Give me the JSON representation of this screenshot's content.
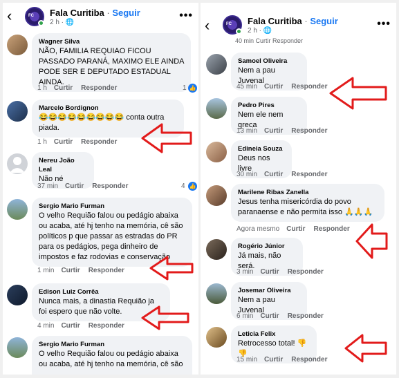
{
  "page": {
    "name": "Fala Curitiba",
    "separator": "·",
    "follow_label": "Seguir",
    "meta": "2 h · ",
    "globe_icon": "globe-icon",
    "more_label": "•••",
    "back_label": "‹",
    "logo_text": "Fala Curitiba"
  },
  "actions": {
    "like": "Curtir",
    "reply": "Responder"
  },
  "left_comments": [
    {
      "author": "Wagner Silva",
      "text": "NÃO, FAMILIA REQUIAO FICOU PASSADO PARANÁ, MAXIMO ELE AINDA PODE SER E DEPUTADO ESTADUAL AINDA.",
      "time": "1 h",
      "likes": "1"
    },
    {
      "author": "Marcelo Bordignon",
      "text": "😂😂😂😂😂😂😂😂😂 conta outra piada.",
      "time": "1 h",
      "likes": ""
    },
    {
      "author": "Nereu João Leal",
      "text": "Não né",
      "time": "37 min",
      "likes": "4"
    },
    {
      "author": "Sergio Mario Furman",
      "text": "O velho Requião falou ou pedágio abaixa ou acaba, até hj tenho na memória, cê são políticos p que passar as estradas do PR para os pedágios, pega dinheiro de impostos e faz rodovias e conservação",
      "time": "1 min",
      "likes": ""
    },
    {
      "author": "Edison Luiz Corrêa",
      "text": "Nunca mais, a dinastia Requião ja foi espero que não volte.",
      "time": "4 min",
      "likes": ""
    },
    {
      "author": "Sergio Mario Furman",
      "text": "O velho Requião falou ou pedágio abaixa ou acaba, até hj tenho na memória, cê são",
      "time": "",
      "likes": ""
    }
  ],
  "right_cut_text": "40 min   Curtir   Responder",
  "right_comments": [
    {
      "author": "Samoel Oliveira",
      "text": "Nem a pau Juvenal",
      "time": "45 min"
    },
    {
      "author": "Pedro Pires",
      "text": "Nem ele nem greca",
      "time": "13 min"
    },
    {
      "author": "Edineia Souza",
      "text": "Deus nos livre",
      "time": "30 min"
    },
    {
      "author": "Marilene Ribas Zanella",
      "text": "Jesus tenha misericórdia do povo paranaense e não permita isso 🙏🙏🙏",
      "time": "Agora mesmo"
    },
    {
      "author": "Rogério Júnior",
      "text": "Já mais, não será.",
      "time": "3 min"
    },
    {
      "author": "Josemar Oliveira",
      "text": "Nem a pau Juvenal",
      "time": "6 min"
    },
    {
      "author": "Leticia Felix",
      "text": "Retrocesso total! 👎👎",
      "time": "15 min"
    }
  ],
  "colors": {
    "accent": "#1877f2",
    "bubble": "#f0f2f5",
    "arrow": "#e21b1b",
    "muted": "#65676b"
  }
}
